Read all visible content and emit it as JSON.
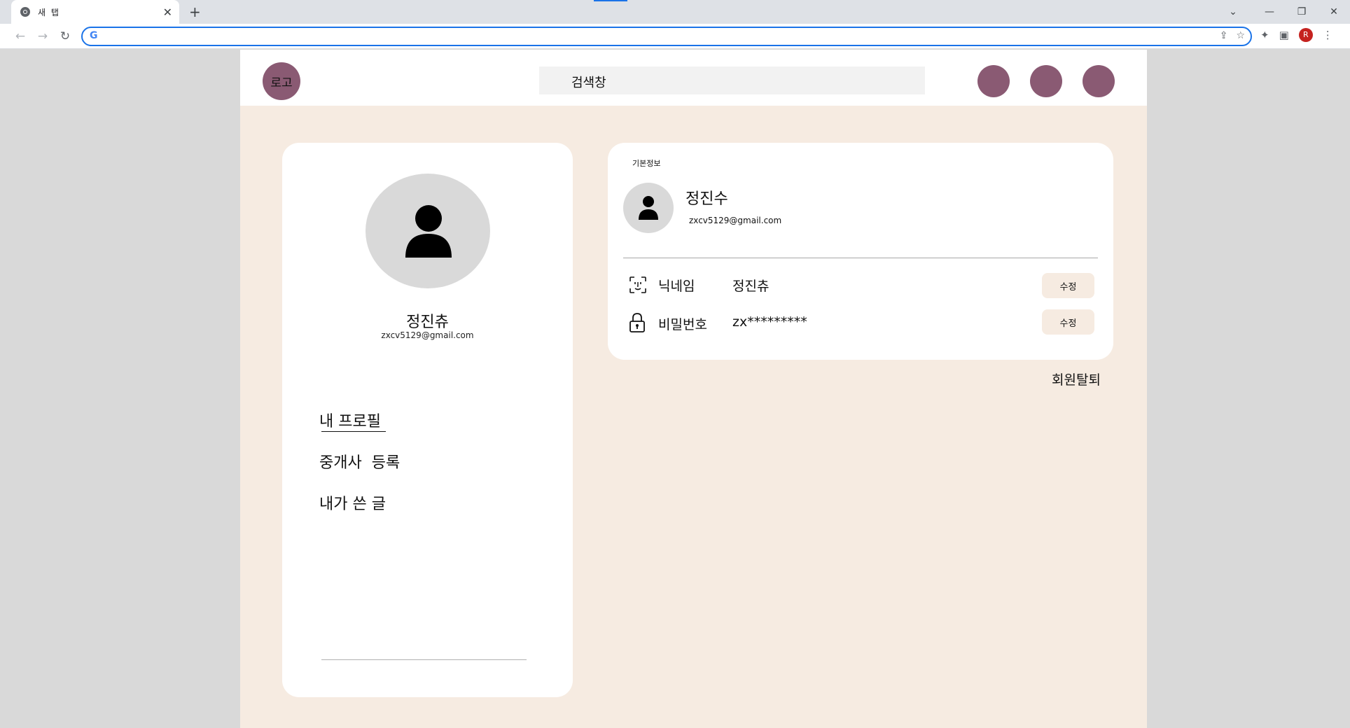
{
  "browser": {
    "tab_title": "새 탭",
    "tab_close": "✕",
    "new_tab": "+",
    "address_value": "",
    "profile_initial": "R"
  },
  "site": {
    "logo_text": "로고",
    "search_placeholder": "검색창"
  },
  "profile_card": {
    "name": "정진츄",
    "email": "zxcv5129@gmail.com",
    "menu": [
      "내 프로필",
      "중개사  등록",
      "내가 쓴 글"
    ]
  },
  "basic_info": {
    "section_label": "기본정보",
    "name": "정진수",
    "email": "zxcv5129@gmail.com",
    "rows": [
      {
        "label": "닉네임",
        "value": "정진츄",
        "button": "수정"
      },
      {
        "label": "비밀번호",
        "value": "zx*********",
        "button": "수정"
      }
    ]
  },
  "withdraw_label": "회원탈퇴",
  "colors": {
    "accent": "#8a5a73",
    "page_bg": "#f6ebe1",
    "card_bg": "#ffffff",
    "avatar_bg": "#d9d9d9"
  }
}
